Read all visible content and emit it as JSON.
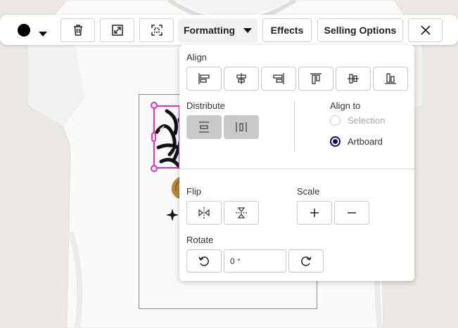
{
  "toolbar": {
    "color_swatch": "#000000",
    "formatting_label": "Formatting",
    "effects_label": "Effects",
    "selling_options_label": "Selling Options",
    "icons": [
      "color-swatch",
      "chevron-down-icon",
      "trash-icon",
      "resize-icon",
      "crop-icon",
      "close-icon"
    ]
  },
  "panel": {
    "align_label": "Align",
    "distribute_label": "Distribute",
    "align_to_label": "Align to",
    "align_to_options": [
      {
        "label": "Selection",
        "selected": false,
        "enabled": false
      },
      {
        "label": "Artboard",
        "selected": true,
        "enabled": true
      }
    ],
    "flip_label": "Flip",
    "scale_label": "Scale",
    "rotate_label": "Rotate",
    "rotate_value": "0 °"
  },
  "colors": {
    "selection": "#e62db5",
    "radio_selected": "#0a0a5a",
    "distribute_disabled": "#c9c9c9"
  }
}
